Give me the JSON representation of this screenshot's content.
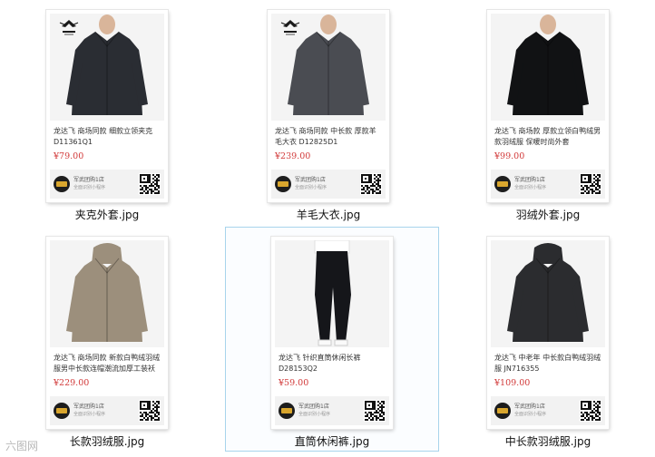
{
  "items": [
    {
      "description": "龙达飞 商场同款 细款立领夹克 D11361Q1",
      "price": "¥79.00",
      "shop": "军武团购1店",
      "shop_sub": "全面识别小程序",
      "filename": "夹克外套.jpg",
      "garment_color": "#2a2d33",
      "has_logo": true
    },
    {
      "description": "龙达飞 商场同款 中长款 厚款羊毛大衣 D12825D1",
      "price": "¥239.00",
      "shop": "军武团购1店",
      "shop_sub": "全面识别小程序",
      "filename": "羊毛大衣.jpg",
      "garment_color": "#4a4c52",
      "has_logo": true
    },
    {
      "description": "龙达飞 商场款 厚款立领白鸭绒男款羽绒服 保暖时尚外套",
      "price": "¥99.00",
      "shop": "军武团购1店",
      "shop_sub": "全面识别小程序",
      "filename": "羽绒外套.jpg",
      "garment_color": "#111214",
      "has_logo": false
    },
    {
      "description": "龙达飞 商场同款 新款白鸭绒羽绒服男中长款连帽潮流加厚工装袄",
      "price": "¥229.00",
      "shop": "军武团购1店",
      "shop_sub": "全面识别小程序",
      "filename": "长款羽绒服.jpg",
      "garment_color": "#9c8f7c",
      "has_logo": false
    },
    {
      "description": "龙达飞 针织直筒休闲长裤 D28153Q2",
      "price": "¥59.00",
      "shop": "军武团购1店",
      "shop_sub": "全面识别小程序",
      "filename": "直筒休闲裤.jpg",
      "garment_color": "#15161a",
      "has_logo": false
    },
    {
      "description": "龙达飞 中老年 中长款白鸭绒羽绒服 JN716355",
      "price": "¥109.00",
      "shop": "军武团购1店",
      "shop_sub": "全面识别小程序",
      "filename": "中长款羽绒服.jpg",
      "garment_color": "#2b2c2f",
      "has_logo": false
    }
  ],
  "selected_index": 4,
  "watermark": "六图网"
}
